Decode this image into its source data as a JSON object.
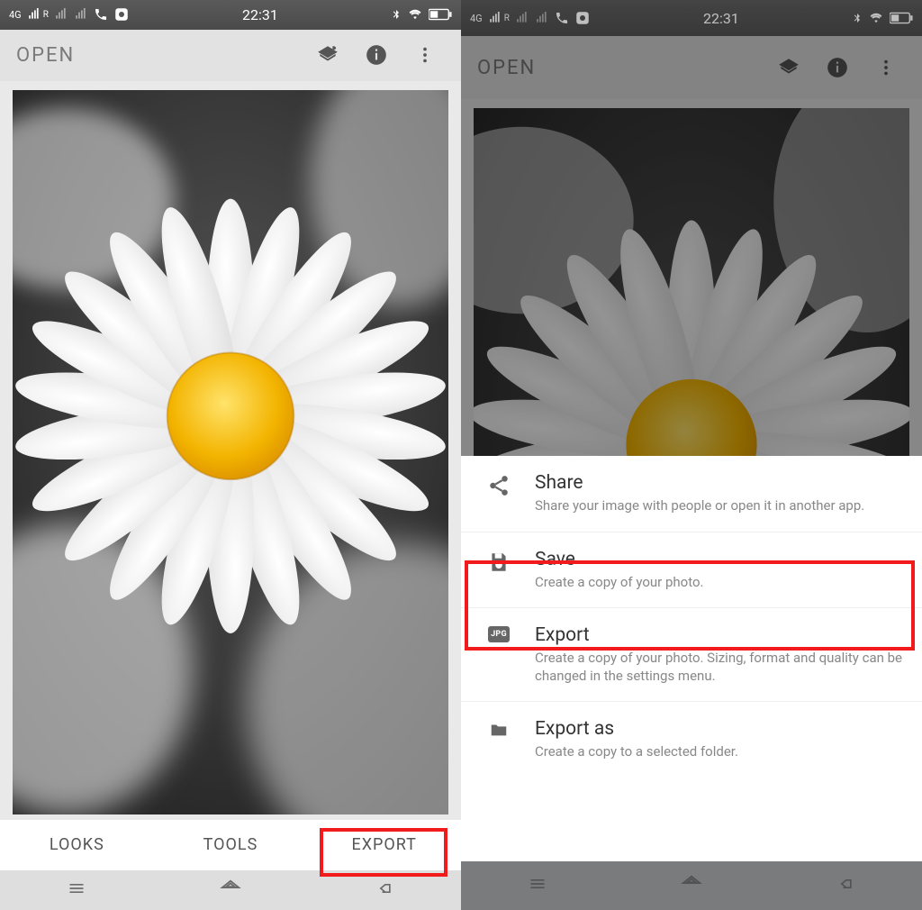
{
  "status": {
    "carrier": "4G",
    "roaming": "R",
    "time": "22:31"
  },
  "header": {
    "open_label": "OPEN"
  },
  "tabs": {
    "looks": "LOOKS",
    "tools": "TOOLS",
    "export": "EXPORT"
  },
  "sheet": {
    "share": {
      "title": "Share",
      "desc": "Share your image with people or open it in another app."
    },
    "save": {
      "title": "Save",
      "desc": "Create a copy of your photo."
    },
    "export": {
      "title": "Export",
      "desc": "Create a copy of your photo. Sizing, format and quality can be changed in the settings menu."
    },
    "exportas": {
      "title": "Export as",
      "desc": "Create a copy to a selected folder."
    },
    "jpg_badge": "JPG"
  }
}
